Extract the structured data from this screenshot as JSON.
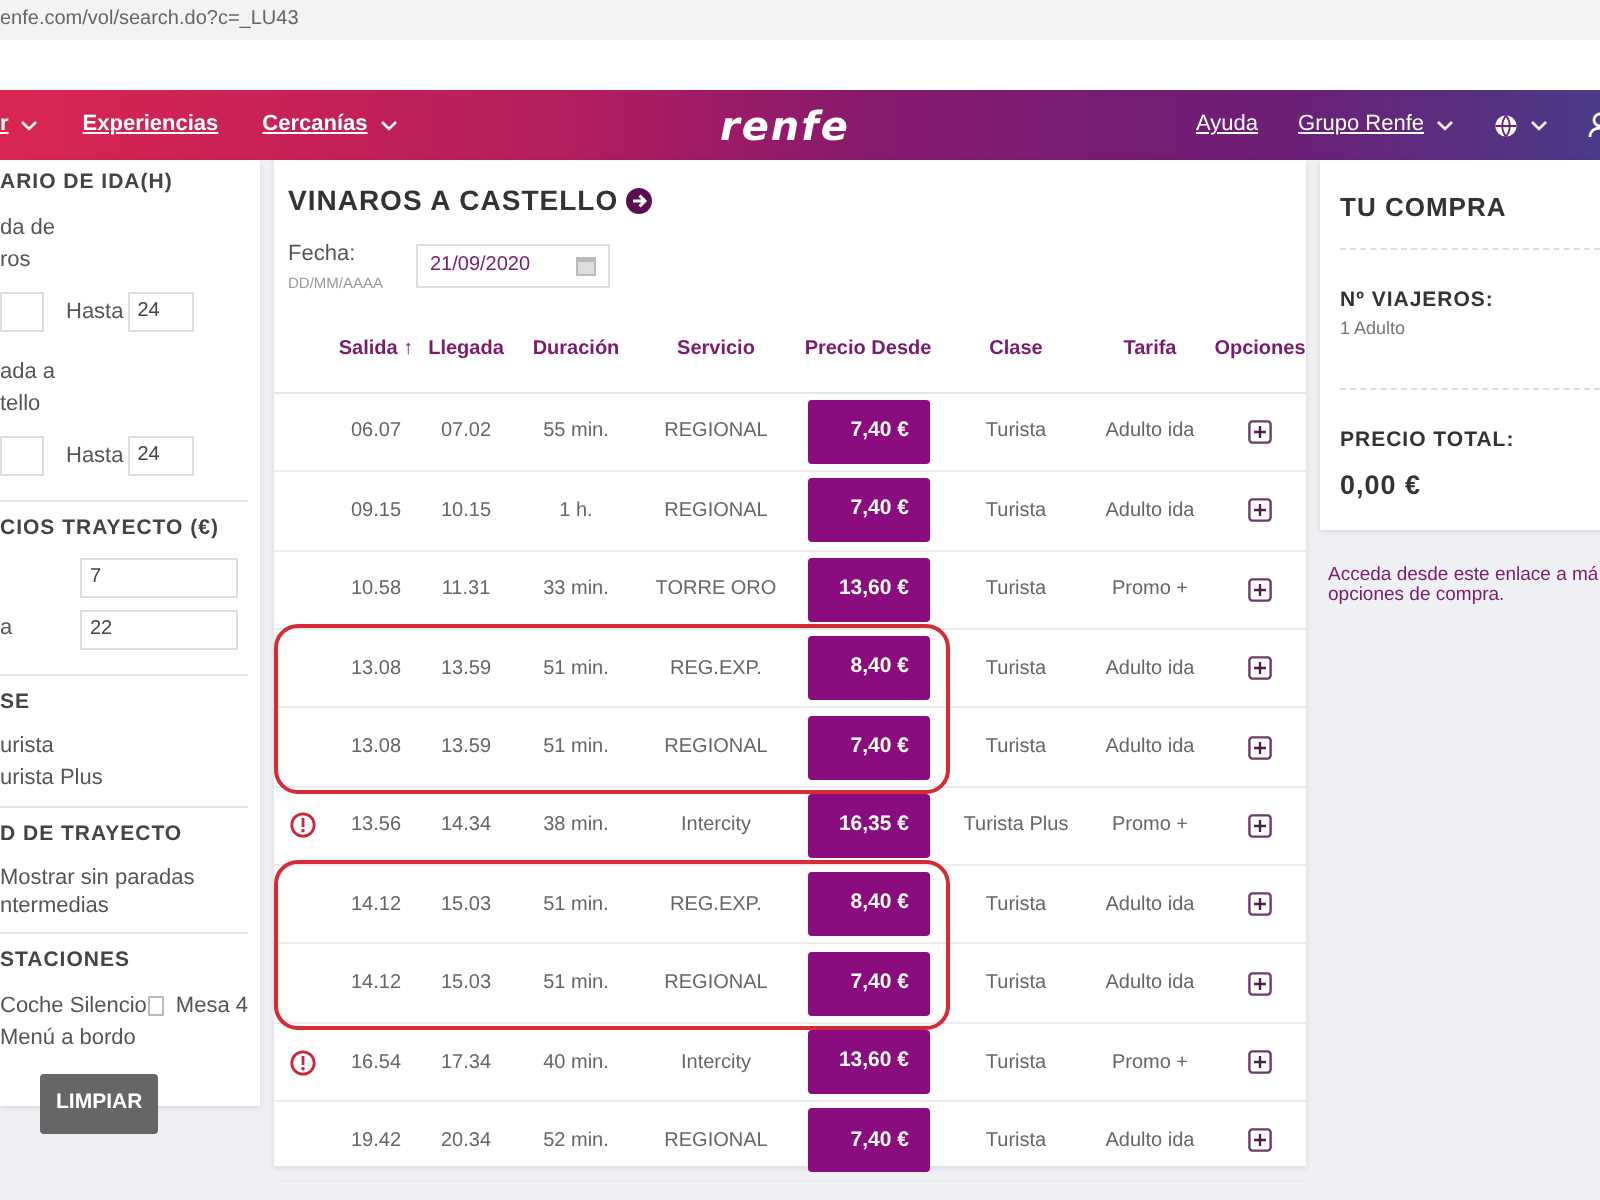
{
  "address_bar": {
    "url": "enfe.com/vol/search.do?c=_LU43"
  },
  "nav": {
    "left": [
      {
        "label": "r",
        "dropdown": true
      },
      {
        "label": "Experiencias",
        "dropdown": false
      },
      {
        "label": "Cercanías",
        "dropdown": true
      }
    ],
    "logo": "renfe",
    "right": [
      {
        "kind": "text",
        "label": "Ayuda",
        "dropdown": false
      },
      {
        "kind": "text",
        "label": "Grupo Renfe",
        "dropdown": true
      },
      {
        "kind": "globe",
        "dropdown": true
      },
      {
        "kind": "user",
        "dropdown": false
      }
    ]
  },
  "sidebar": {
    "hours": {
      "title": "ARIO DE IDA(H)",
      "ranges": [
        {
          "label": [
            "da de",
            "ros"
          ],
          "to_label": "Hasta",
          "to_value": "24"
        },
        {
          "label": [
            "ada a",
            "tello"
          ],
          "to_label": "Hasta",
          "to_value": "24"
        }
      ]
    },
    "prices": {
      "title": "CIOS TRAYECTO (€)",
      "fields": [
        {
          "value": "7"
        },
        {
          "label": "a",
          "value": "22"
        }
      ]
    },
    "classes": {
      "title": "SE",
      "options": [
        "urista",
        "urista Plus"
      ]
    },
    "route_type": {
      "title": "D DE TRAYECTO",
      "option": [
        "Mostrar sin paradas",
        "ntermedias"
      ]
    },
    "services": {
      "title": "STACIONES",
      "items": [
        {
          "label": "Coche Silencio"
        },
        {
          "label": "Mesa 4",
          "checked": false
        },
        {
          "label": "Menú a bordo"
        }
      ]
    },
    "clear_button": "LIMPIAR"
  },
  "results": {
    "title": "VINAROS A CASTELLO",
    "date_label": "Fecha:",
    "date_hint": "DD/MM/AAAA",
    "date": "21/09/2020",
    "columns": [
      {
        "label": "Salida",
        "sort": "↑"
      },
      {
        "label": "Llegada"
      },
      {
        "label": "Duración"
      },
      {
        "label": "Servicio"
      },
      {
        "label": "Precio Desde"
      },
      {
        "label": "Clase"
      },
      {
        "label": "Tarifa"
      },
      {
        "label": "Opciones"
      }
    ],
    "rows": [
      {
        "alert": false,
        "circled": false,
        "cells": [
          "06.07",
          "07.02",
          "55 min.",
          "REGIONAL",
          "7,40 €",
          "Turista",
          "Adulto ida"
        ]
      },
      {
        "alert": false,
        "circled": false,
        "cells": [
          "09.15",
          "10.15",
          "1 h.",
          "REGIONAL",
          "7,40 €",
          "Turista",
          "Adulto ida"
        ]
      },
      {
        "alert": false,
        "circled": false,
        "cells": [
          "10.58",
          "11.31",
          "33 min.",
          "TORRE ORO",
          "13,60 €",
          "Turista",
          "Promo +"
        ]
      },
      {
        "alert": false,
        "circled": true,
        "cells": [
          "13.08",
          "13.59",
          "51 min.",
          "REG.EXP.",
          "8,40 €",
          "Turista",
          "Adulto ida"
        ]
      },
      {
        "alert": false,
        "circled": true,
        "cells": [
          "13.08",
          "13.59",
          "51 min.",
          "REGIONAL",
          "7,40 €",
          "Turista",
          "Adulto ida"
        ]
      },
      {
        "alert": true,
        "circled": false,
        "cells": [
          "13.56",
          "14.34",
          "38 min.",
          "Intercity",
          "16,35 €",
          "Turista Plus",
          "Promo +"
        ]
      },
      {
        "alert": false,
        "circled": true,
        "cells": [
          "14.12",
          "15.03",
          "51 min.",
          "REG.EXP.",
          "8,40 €",
          "Turista",
          "Adulto ida"
        ]
      },
      {
        "alert": false,
        "circled": true,
        "cells": [
          "14.12",
          "15.03",
          "51 min.",
          "REGIONAL",
          "7,40 €",
          "Turista",
          "Adulto ida"
        ]
      },
      {
        "alert": true,
        "circled": false,
        "cells": [
          "16.54",
          "17.34",
          "40 min.",
          "Intercity",
          "13,60 €",
          "Turista",
          "Promo +"
        ]
      },
      {
        "alert": false,
        "circled": false,
        "cells": [
          "19.42",
          "20.34",
          "52 min.",
          "REGIONAL",
          "7,40 €",
          "Turista",
          "Adulto ida"
        ]
      }
    ]
  },
  "purchase": {
    "title": "TU COMPRA",
    "travelers_label": "Nº VIAJEROS:",
    "travelers": "1 Adulto",
    "total_label": "PRECIO TOTAL:",
    "total": "0,00 €"
  },
  "more_link": [
    "Acceda desde este enlace a má",
    "opciones de compra."
  ]
}
